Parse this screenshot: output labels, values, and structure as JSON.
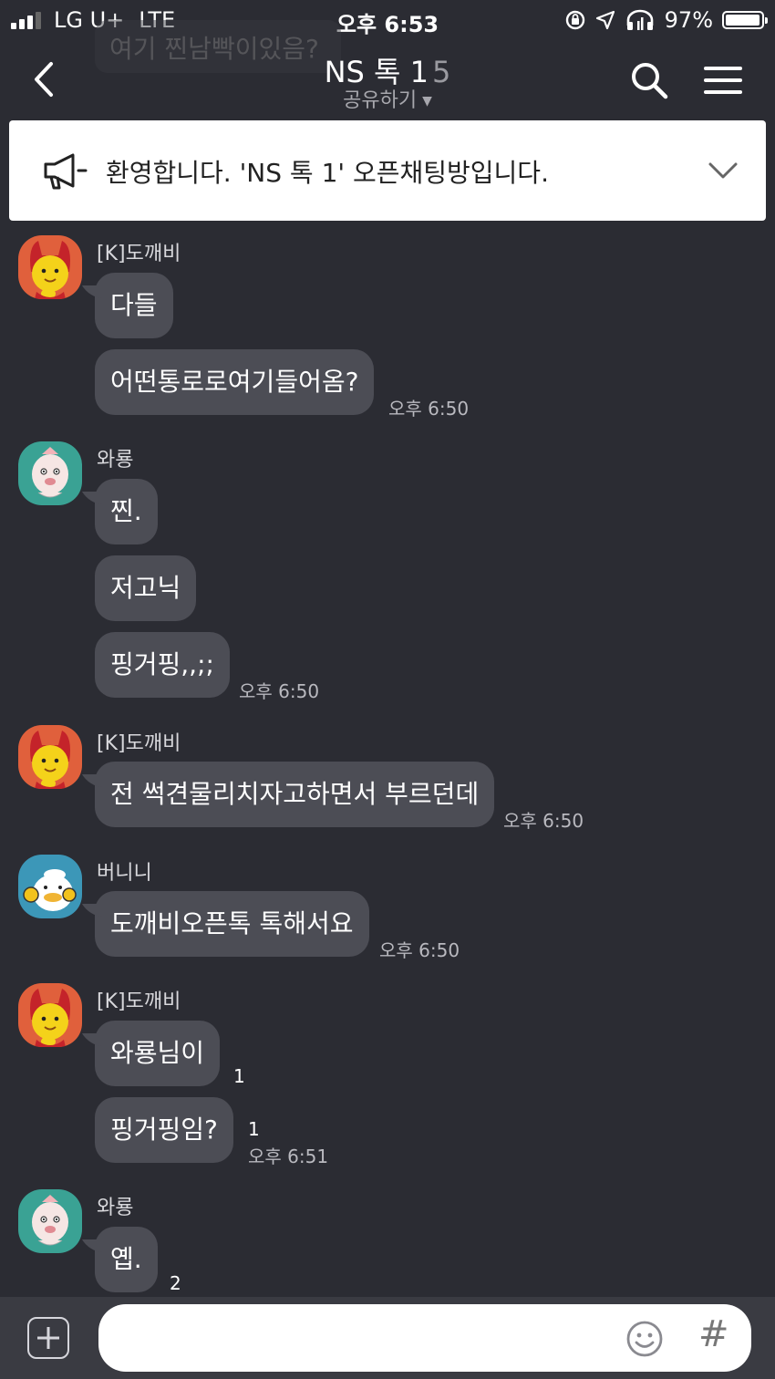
{
  "status_bar": {
    "carrier": "LG U+",
    "network": "LTE",
    "time": "오후 6:53",
    "battery": "97%",
    "battery_level": 0.97
  },
  "ghost_message": "여기 찐남빡이있음?",
  "header": {
    "title": "NS 톡 1",
    "member_count": "5",
    "share_label": "공유하기"
  },
  "notice": {
    "text": "환영합니다. 'NS 톡 1' 오픈채팅방입니다."
  },
  "messages": [
    {
      "sender": "[K]도깨비",
      "bubbles": [
        "다들",
        "어떤통로로여기들어옴?"
      ],
      "time": "오후 6:50"
    },
    {
      "sender": "와룡",
      "bubbles": [
        "찐.",
        "저고닉",
        "핑거핑,,;;"
      ],
      "time": "오후 6:50"
    },
    {
      "sender": "[K]도깨비",
      "bubbles": [
        "전 썩견물리치자고하면서 부르던데"
      ],
      "time": "오후 6:50"
    },
    {
      "sender": "버니니",
      "bubbles": [
        "도깨비오픈톡 톡해서요"
      ],
      "time": "오후 6:50"
    },
    {
      "sender": "[K]도깨비",
      "bubbles": [
        "와룡님이",
        "핑거핑임?"
      ],
      "unread": [
        "1",
        "1"
      ],
      "time": "오후 6:51"
    },
    {
      "sender": "와룡",
      "bubbles": [
        "옙."
      ],
      "unread": [
        "2"
      ]
    }
  ],
  "input": {
    "placeholder": ""
  },
  "icons": {
    "back": "back-arrow-icon",
    "search": "search-icon",
    "menu": "hamburger-menu-icon",
    "notice": "megaphone-icon",
    "expand": "chevron-down-icon",
    "attach": "plus-icon",
    "emoji": "emoji-icon",
    "hashtag": "hashtag-icon"
  }
}
